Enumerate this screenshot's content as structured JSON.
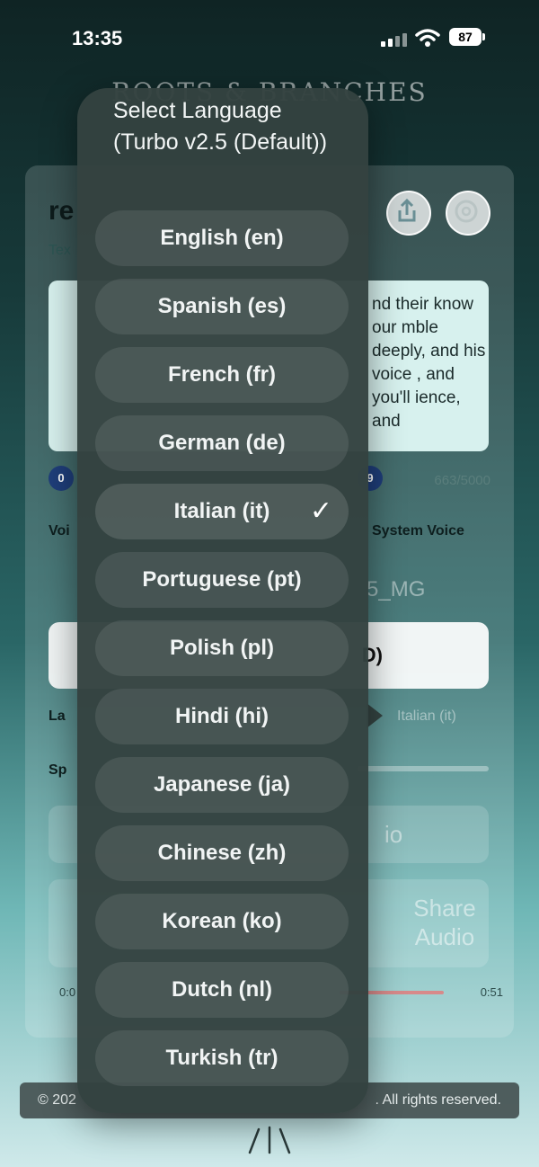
{
  "status_bar": {
    "time": "13:35",
    "battery": "87"
  },
  "brand": "ROOTS & BRANCHES",
  "background_card": {
    "title_fragment": "re",
    "subtitle_fragment": "Tex",
    "text_fragment": "nd their know our mble deeply, and his voice , and you'll ience, and",
    "badge_left": "0",
    "badge_right": "9",
    "char_count": "663/5000",
    "voice_label_fragment": "Voi",
    "system_voice": "System Voice",
    "voice_id_fragment": "5_MG",
    "white_button_fragment": "D)",
    "language_label_fragment": "La",
    "language_value": "Italian (it)",
    "speed_label_fragment": "Sp",
    "audio_fragment": "io",
    "share_audio": "Share Audio",
    "time_start": "0:0",
    "time_end": "0:51"
  },
  "footer": {
    "left": "© 202",
    "right": ". All rights reserved."
  },
  "language_menu": {
    "title": "Select Language (Turbo v2.5 (Default))",
    "check_glyph": "✓",
    "options": [
      {
        "label": "English (en)",
        "selected": false
      },
      {
        "label": "Spanish (es)",
        "selected": false
      },
      {
        "label": "French (fr)",
        "selected": false
      },
      {
        "label": "German (de)",
        "selected": false
      },
      {
        "label": "Italian (it)",
        "selected": true
      },
      {
        "label": "Portuguese (pt)",
        "selected": false
      },
      {
        "label": "Polish (pl)",
        "selected": false
      },
      {
        "label": "Hindi (hi)",
        "selected": false
      },
      {
        "label": "Japanese (ja)",
        "selected": false
      },
      {
        "label": "Chinese (zh)",
        "selected": false
      },
      {
        "label": "Korean (ko)",
        "selected": false
      },
      {
        "label": "Dutch (nl)",
        "selected": false
      },
      {
        "label": "Turkish (tr)",
        "selected": false
      }
    ]
  },
  "icons": {
    "share": "share-icon",
    "settings": "gear-icon",
    "wifi": "wifi-icon",
    "signal": "signal-icon",
    "battery": "battery-icon"
  }
}
